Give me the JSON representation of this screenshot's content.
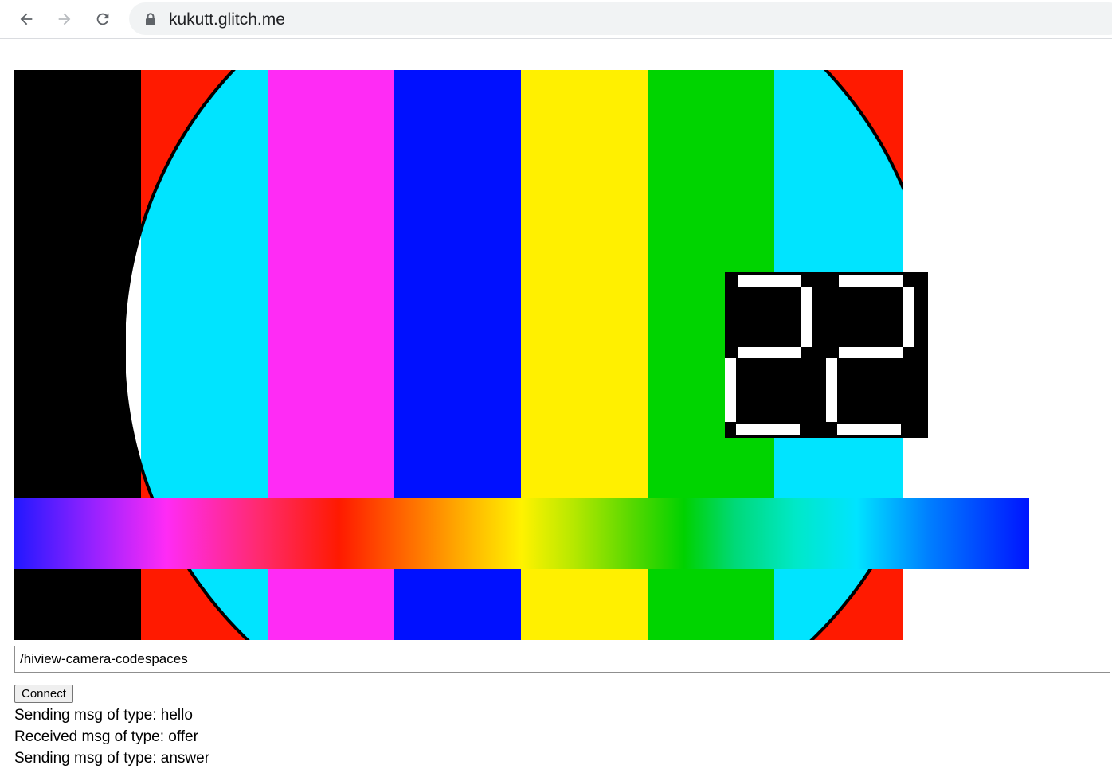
{
  "browser": {
    "url": "kukutt.glitch.me",
    "back_icon": "back-arrow-icon",
    "forward_icon": "forward-arrow-icon",
    "reload_icon": "reload-icon",
    "lock_icon": "lock-icon"
  },
  "video": {
    "bar_colors": [
      "#000000",
      "#ff1a00",
      "#ff2bf5",
      "#0010ff",
      "#fff000",
      "#00d400",
      "#ff1a00"
    ],
    "circle_colors": [
      "#00e4ff",
      "#ffffff"
    ],
    "counter_value": "22"
  },
  "form": {
    "room_value": "/hiview-camera-codespaces",
    "connect_label": "Connect"
  },
  "log": [
    "Sending msg of type: hello",
    "Received msg of type: offer",
    "Sending msg of type: answer"
  ]
}
